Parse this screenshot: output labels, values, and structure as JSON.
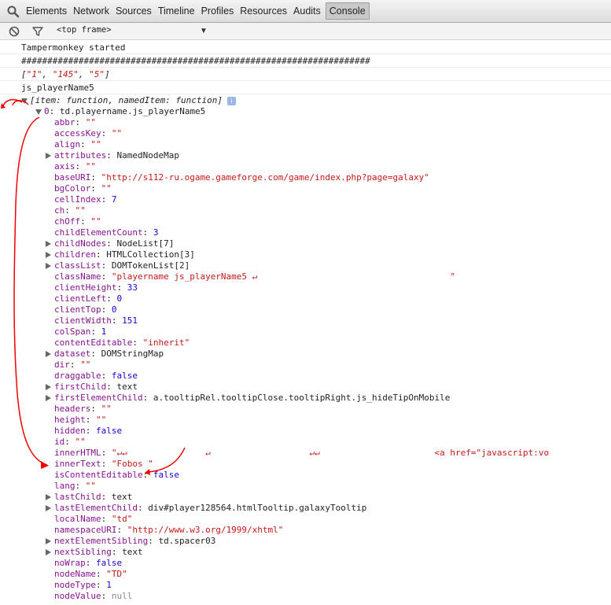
{
  "tabs": [
    "Elements",
    "Network",
    "Sources",
    "Timeline",
    "Profiles",
    "Resources",
    "Audits",
    "Console"
  ],
  "frame_selector": "<top frame>",
  "messages": {
    "m1": "Tampermonkey started",
    "m2": "###################################################################",
    "m3_parts": [
      "[",
      "\"1\"",
      ", ",
      "\"145\"",
      ", ",
      "\"5\"",
      "]"
    ],
    "m4": "js_playerName5"
  },
  "tree": {
    "root_label": "[item: function, namedItem: function]",
    "info_glyph": "i",
    "child_index": "0",
    "child_type": "td.playername.js_playerName5",
    "props": [
      {
        "k": "abbr",
        "v": "\"\"",
        "c": "s",
        "e": false
      },
      {
        "k": "accessKey",
        "v": "\"\"",
        "c": "s",
        "e": false
      },
      {
        "k": "align",
        "v": "\"\"",
        "c": "s",
        "e": false
      },
      {
        "k": "attributes",
        "v": "NamedNodeMap",
        "c": "t",
        "e": true
      },
      {
        "k": "axis",
        "v": "\"\"",
        "c": "s",
        "e": false
      },
      {
        "k": "baseURI",
        "v": "\"http://s112-ru.ogame.gameforge.com/game/index.php?page=galaxy\"",
        "c": "s",
        "e": false
      },
      {
        "k": "bgColor",
        "v": "\"\"",
        "c": "s",
        "e": false
      },
      {
        "k": "cellIndex",
        "v": "7",
        "c": "n",
        "e": false
      },
      {
        "k": "ch",
        "v": "\"\"",
        "c": "s",
        "e": false
      },
      {
        "k": "chOff",
        "v": "\"\"",
        "c": "s",
        "e": false
      },
      {
        "k": "childElementCount",
        "v": "3",
        "c": "n",
        "e": false
      },
      {
        "k": "childNodes",
        "v": "NodeList[7]",
        "c": "t",
        "e": true
      },
      {
        "k": "children",
        "v": "HTMLCollection[3]",
        "c": "t",
        "e": true
      },
      {
        "k": "classList",
        "v": "DOMTokenList[2]",
        "c": "t",
        "e": true
      },
      {
        "k": "className",
        "v": "\"playername js_playerName5 ↵                                     \"",
        "c": "s",
        "e": false
      },
      {
        "k": "clientHeight",
        "v": "33",
        "c": "n",
        "e": false
      },
      {
        "k": "clientLeft",
        "v": "0",
        "c": "n",
        "e": false
      },
      {
        "k": "clientTop",
        "v": "0",
        "c": "n",
        "e": false
      },
      {
        "k": "clientWidth",
        "v": "151",
        "c": "n",
        "e": false
      },
      {
        "k": "colSpan",
        "v": "1",
        "c": "n",
        "e": false
      },
      {
        "k": "contentEditable",
        "v": "\"inherit\"",
        "c": "s",
        "e": false
      },
      {
        "k": "dataset",
        "v": "DOMStringMap",
        "c": "t",
        "e": true
      },
      {
        "k": "dir",
        "v": "\"\"",
        "c": "s",
        "e": false
      },
      {
        "k": "draggable",
        "v": "false",
        "c": "n",
        "e": false
      },
      {
        "k": "firstChild",
        "v": "text",
        "c": "t",
        "e": true
      },
      {
        "k": "firstElementChild",
        "v": "a.tooltipRel.tooltipClose.tooltipRight.js_hideTipOnMobile",
        "c": "t",
        "e": true
      },
      {
        "k": "headers",
        "v": "\"\"",
        "c": "s",
        "e": false
      },
      {
        "k": "height",
        "v": "\"\"",
        "c": "s",
        "e": false
      },
      {
        "k": "hidden",
        "v": "false",
        "c": "n",
        "e": false
      },
      {
        "k": "id",
        "v": "\"\"",
        "c": "s",
        "e": false
      },
      {
        "k": "innerHTML",
        "v": "\"↵↵               ↵                   ↵↵                      <a href=\"javascript:vo",
        "c": "s",
        "e": false
      },
      {
        "k": "innerText",
        "v": "\"Fobos \"",
        "c": "s",
        "e": false
      },
      {
        "k": "isContentEditable",
        "v": "false",
        "c": "n",
        "e": false
      },
      {
        "k": "lang",
        "v": "\"\"",
        "c": "s",
        "e": false
      },
      {
        "k": "lastChild",
        "v": "text",
        "c": "t",
        "e": true
      },
      {
        "k": "lastElementChild",
        "v": "div#player128564.htmlTooltip.galaxyTooltip",
        "c": "t",
        "e": true
      },
      {
        "k": "localName",
        "v": "\"td\"",
        "c": "s",
        "e": false
      },
      {
        "k": "namespaceURI",
        "v": "\"http://www.w3.org/1999/xhtml\"",
        "c": "s",
        "e": false
      },
      {
        "k": "nextElementSibling",
        "v": "td.spacer03",
        "c": "t",
        "e": true
      },
      {
        "k": "nextSibling",
        "v": "text",
        "c": "t",
        "e": true
      },
      {
        "k": "noWrap",
        "v": "false",
        "c": "n",
        "e": false
      },
      {
        "k": "nodeName",
        "v": "\"TD\"",
        "c": "s",
        "e": false
      },
      {
        "k": "nodeType",
        "v": "1",
        "c": "n",
        "e": false
      },
      {
        "k": "nodeValue",
        "v": "null",
        "c": "lt",
        "e": false
      }
    ]
  }
}
